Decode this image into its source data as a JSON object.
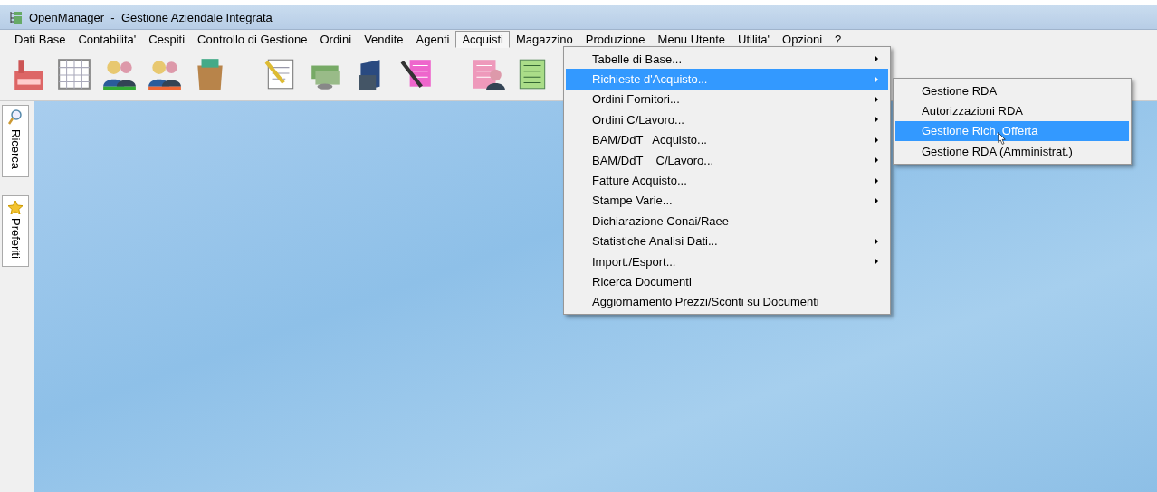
{
  "window": {
    "title": "OpenManager  -  Gestione Aziendale Integrata"
  },
  "menu_bar": [
    {
      "label": "Dati Base",
      "selected": false
    },
    {
      "label": "Contabilita'",
      "selected": false
    },
    {
      "label": "Cespiti",
      "selected": false
    },
    {
      "label": "Controllo di Gestione",
      "selected": false
    },
    {
      "label": "Ordini",
      "selected": false
    },
    {
      "label": "Vendite",
      "selected": false
    },
    {
      "label": "Agenti",
      "selected": false
    },
    {
      "label": "Acquisti",
      "selected": true
    },
    {
      "label": "Magazzino",
      "selected": false
    },
    {
      "label": "Produzione",
      "selected": false
    },
    {
      "label": "Menu Utente",
      "selected": false
    },
    {
      "label": "Utilita'",
      "selected": false
    },
    {
      "label": "Opzioni",
      "selected": false
    },
    {
      "label": "?",
      "selected": false
    }
  ],
  "side_tabs": [
    {
      "label": "Ricerca",
      "kind": "search"
    },
    {
      "label": "Preferiti",
      "kind": "favorites"
    }
  ],
  "dropdown_menu": [
    {
      "label": "Tabelle di Base...",
      "has_submenu": true,
      "selected": false
    },
    {
      "label": "Richieste d'Acquisto...",
      "has_submenu": true,
      "selected": true
    },
    {
      "label": "Ordini Fornitori...",
      "has_submenu": true,
      "selected": false
    },
    {
      "label": "Ordini C/Lavoro...",
      "has_submenu": true,
      "selected": false
    },
    {
      "label": "BAM/DdT   Acquisto...",
      "has_submenu": true,
      "selected": false
    },
    {
      "label": "BAM/DdT    C/Lavoro...",
      "has_submenu": true,
      "selected": false
    },
    {
      "label": "Fatture Acquisto...",
      "has_submenu": true,
      "selected": false
    },
    {
      "label": "Stampe Varie...",
      "has_submenu": true,
      "selected": false
    },
    {
      "label": "Dichiarazione Conai/Raee",
      "has_submenu": false,
      "selected": false
    },
    {
      "label": "Statistiche Analisi Dati...",
      "has_submenu": true,
      "selected": false
    },
    {
      "label": "Import./Esport...",
      "has_submenu": true,
      "selected": false
    },
    {
      "label": "Ricerca Documenti",
      "has_submenu": false,
      "selected": false
    },
    {
      "label": "Aggiornamento Prezzi/Sconti su Documenti",
      "has_submenu": false,
      "selected": false
    }
  ],
  "submenu": [
    {
      "label": "Gestione RDA",
      "selected": false
    },
    {
      "label": "Autorizzazioni RDA",
      "selected": false
    },
    {
      "label": "Gestione Rich. Offerta",
      "selected": true
    },
    {
      "label": "Gestione RDA (Amministrat.)",
      "selected": false
    }
  ]
}
